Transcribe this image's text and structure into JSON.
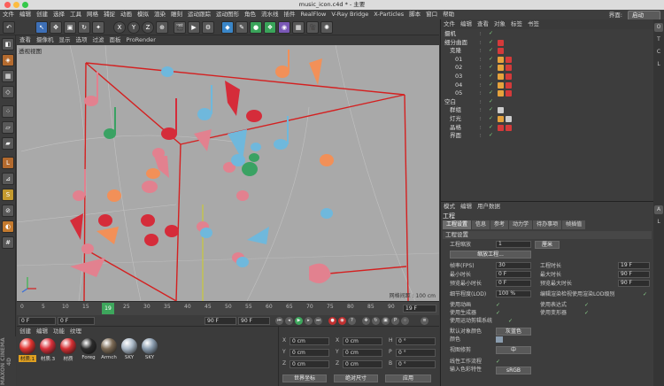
{
  "window": {
    "title": "music_icon.c4d * - 主要"
  },
  "menubar": [
    "文件",
    "编辑",
    "创建",
    "选择",
    "工具",
    "网格",
    "捕捉",
    "动画",
    "模拟",
    "渲染",
    "雕刻",
    "运动跟踪",
    "运动图形",
    "角色",
    "流水线",
    "插件",
    "RealFlow",
    "V-Ray Bridge",
    "X-Particles",
    "脚本",
    "窗口",
    "帮助"
  ],
  "layout": {
    "label": "界面:",
    "value": "启动"
  },
  "toolbar": {
    "icons": [
      "undo-icon",
      "select-icon",
      "move-icon",
      "scale-icon",
      "rotate-icon",
      "last-tool-icon",
      "x-axis-icon",
      "y-axis-icon",
      "z-axis-icon",
      "coord-system-icon",
      "render-region-icon",
      "render-view-icon",
      "render-settings-icon",
      "cube-icon",
      "pen-icon",
      "subdivide-icon",
      "array-icon",
      "deformer-icon",
      "camera-icon",
      "light-icon"
    ],
    "xyz": [
      "X",
      "Y",
      "Z"
    ]
  },
  "viewport": {
    "menu": [
      "查看",
      "摄像机",
      "显示",
      "选项",
      "过滤",
      "面板",
      "ProRender"
    ],
    "label": "透视视图",
    "grid_label": "网格间距 : 100 cm"
  },
  "timeline": {
    "ticks": [
      "0",
      "5",
      "10",
      "15",
      "20",
      "25",
      "30",
      "35",
      "40",
      "45",
      "50",
      "55",
      "60",
      "65",
      "70",
      "75",
      "80",
      "85",
      "90"
    ],
    "current": "19",
    "end": "19 F"
  },
  "transport": {
    "start": "0 F",
    "range_start": "0 F",
    "range_end": "90 F",
    "end": "90 F"
  },
  "materials": {
    "menu": [
      "创建",
      "编辑",
      "功能",
      "纹理"
    ],
    "items": [
      {
        "label": "材质.1",
        "color": "#e0332f"
      },
      {
        "label": "材质.3",
        "color": "#d9303a"
      },
      {
        "label": "材质",
        "color": "#d42f32"
      },
      {
        "label": "Foreg",
        "color": "#2b2b2b"
      },
      {
        "label": "Armch",
        "color": "#7b6a55"
      },
      {
        "label": "SKY",
        "color": "#a9b7c5"
      },
      {
        "label": "SKY",
        "color": "#8a9cae"
      }
    ]
  },
  "coords": {
    "rows": [
      {
        "a": "X",
        "av": "0 cm",
        "b": "X",
        "bv": "0 cm",
        "c": "H",
        "cv": "0 °"
      },
      {
        "a": "Y",
        "av": "0 cm",
        "b": "Y",
        "bv": "0 cm",
        "c": "P",
        "cv": "0 °"
      },
      {
        "a": "Z",
        "av": "0 cm",
        "b": "Z",
        "bv": "0 cm",
        "c": "B",
        "cv": "0 °"
      }
    ],
    "mode1": "世界坐标",
    "mode2": "绝对尺寸",
    "apply": "应用"
  },
  "objects": {
    "menu": [
      "文件",
      "编辑",
      "查看",
      "对象",
      "标签",
      "书签"
    ],
    "rows": [
      {
        "name": "摄机",
        "indent": 0,
        "tags": []
      },
      {
        "name": "细分曲面",
        "indent": 0,
        "tags": [
          "#d43a3a"
        ]
      },
      {
        "name": "克隆",
        "indent": 1,
        "tags": [
          "#d43a3a"
        ]
      },
      {
        "name": "01",
        "indent": 2,
        "tags": [
          "#e6a23c",
          "#d43a3a"
        ]
      },
      {
        "name": "02",
        "indent": 2,
        "tags": [
          "#e6a23c",
          "#d43a3a"
        ]
      },
      {
        "name": "03",
        "indent": 2,
        "tags": [
          "#e6a23c",
          "#d43a3a"
        ]
      },
      {
        "name": "04",
        "indent": 2,
        "tags": [
          "#e6a23c",
          "#d43a3a"
        ]
      },
      {
        "name": "05",
        "indent": 2,
        "tags": [
          "#e6a23c",
          "#d43a3a"
        ]
      },
      {
        "name": "空白",
        "indent": 0,
        "tags": []
      },
      {
        "name": "群组",
        "indent": 1,
        "tags": [
          "#cccccc"
        ]
      },
      {
        "name": "灯光",
        "indent": 1,
        "tags": [
          "#e6a23c",
          "#cccccc"
        ]
      },
      {
        "name": "晶格",
        "indent": 1,
        "tags": [
          "#d43a3a",
          "#d43a3a"
        ]
      },
      {
        "name": "界面",
        "indent": 1,
        "tags": []
      }
    ]
  },
  "attributes": {
    "menu": [
      "模式",
      "编辑",
      "用户数据"
    ],
    "title": "工程",
    "tabs": [
      "工程设置",
      "信息",
      "参考",
      "动力学",
      "待办事项",
      "帧插值"
    ],
    "section1": "工程设置",
    "scale_label": "工程缩放",
    "scale_value": "1",
    "scale_unit": "厘米",
    "scale_btn": "缩放工程...",
    "fps_label": "帧率(FPS)",
    "fps": "30",
    "duration_label": "工程时长",
    "duration": "19 F",
    "min_label": "最小时长",
    "min": "0 F",
    "max_label": "最大时长",
    "max": "90 F",
    "pmin_label": "预览最小时长",
    "pmin": "0 F",
    "pmax_label": "预览最大时长",
    "pmax": "90 F",
    "lod_label": "细节程度(LOD)",
    "lod": "100 %",
    "lod_render_label": "编辑渲染检视使用渲染LOD级别",
    "anim_label": "使用动画",
    "expr_label": "使用表达式",
    "gen_label": "使用生成器",
    "deform_label": "使用变形器",
    "motion_label": "使用运动剪辑系统",
    "defcolor_label": "默认对象颜色",
    "defcolor": "灰蓝色",
    "color_label": "颜色",
    "section2": "视图修剪",
    "clip": "中",
    "linear_label": "线性工作流程",
    "input_label": "输入色彩特性",
    "input": "sRGB"
  }
}
